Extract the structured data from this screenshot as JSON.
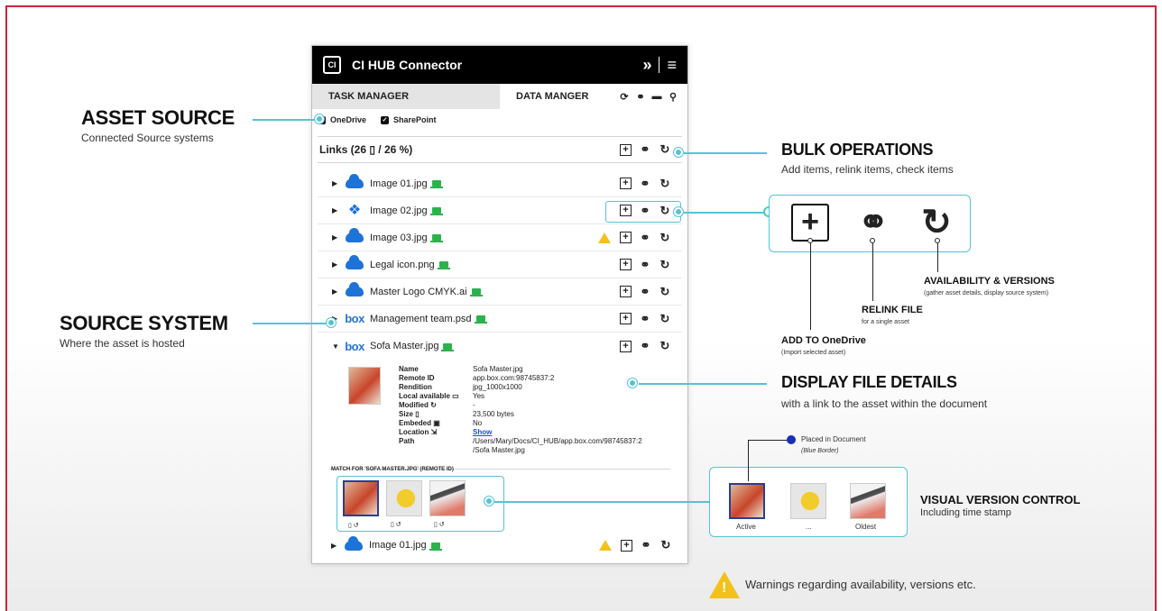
{
  "panel": {
    "app_title": "CI HUB Connector",
    "logo_text": "CI",
    "tab_task": "TASK MANAGER",
    "tab_data": "DATA MANGER",
    "sources": [
      "OneDrive",
      "SharePoint"
    ],
    "links_header": "Links (26 ▯ / 26 %)",
    "files": [
      {
        "name": "Image 01.jpg",
        "source": "onedrive",
        "warning": false,
        "expanded": false
      },
      {
        "name": "Image 02.jpg",
        "source": "dropbox",
        "warning": false,
        "expanded": false
      },
      {
        "name": "Image 03.jpg",
        "source": "onedrive",
        "warning": true,
        "expanded": false
      },
      {
        "name": "Legal icon.png",
        "source": "onedrive",
        "warning": false,
        "expanded": false
      },
      {
        "name": "Master Logo CMYK.ai",
        "source": "onedrive",
        "warning": false,
        "expanded": false
      },
      {
        "name": "Management team.psd",
        "source": "box",
        "warning": false,
        "expanded": false
      },
      {
        "name": "Sofa Master.jpg",
        "source": "box",
        "warning": false,
        "expanded": true
      }
    ],
    "box_logo": "box",
    "details": {
      "Name": "Sofa Master.jpg",
      "Remote ID": "app.box.com:98745837:2",
      "Rendition": "jpg_1000x1000",
      "Local available": "Yes",
      "Modified": "-",
      "Size": "23,500 bytes",
      "Embeded": "No",
      "Location": "Show",
      "Path": "/Users/Mary/Docs/CI_HUB/app.box.com/98745837:2",
      "Path2": "/Sofa Master.jpg"
    },
    "match_label": "MATCH FOR 'SOFA MASTER.JPG' (REMOTE ID)",
    "version_caps": [
      "▯ ↺",
      "▯ ↺",
      "▯ ↺"
    ],
    "last_file": "Image 01.jpg"
  },
  "annotations": {
    "asset_source_title": "ASSET SOURCE",
    "asset_source_sub": "Connected Source systems",
    "source_system_title": "SOURCE SYSTEM",
    "source_system_sub": "Where the asset is hosted",
    "bulk_title": "BULK OPERATIONS",
    "bulk_sub": "Add items, relink items, check items",
    "avail_title": "AVAILABILITY & VERSIONS",
    "avail_sub": "(gather asset details, display source system)",
    "relink_title": "RELINK FILE",
    "relink_sub": "for a single asset",
    "add_title": "ADD TO OneDrive",
    "add_sub": "(Import selected asset)",
    "display_title": "DISPLAY FILE DETAILS",
    "display_sub": "with a link to the asset within the document",
    "placed_title": "Placed in Document",
    "placed_sub": "(Blue Border)",
    "vvc_title": "VISUAL VERSION CONTROL",
    "vvc_sub": "Including time stamp",
    "vvc_caps": [
      "Active",
      "...",
      "Oldest"
    ],
    "warnings": "Warnings regarding availability, versions etc."
  },
  "colors": {
    "accent": "#57c2d6",
    "frame": "#c8283a",
    "warning": "#f2c21b",
    "placed": "#1a2fb8"
  }
}
